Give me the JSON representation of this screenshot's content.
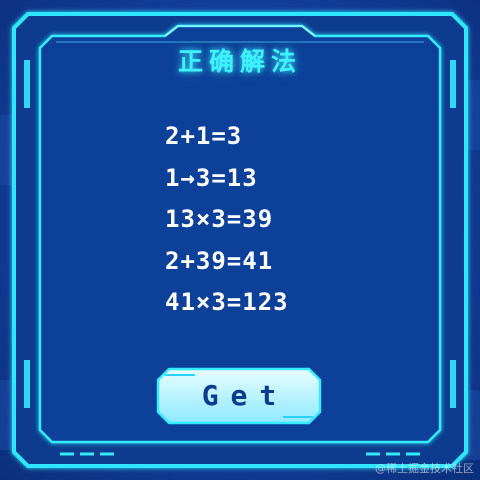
{
  "panel": {
    "title": "正确解法",
    "steps": [
      "2+1=3",
      "1→3=13",
      "13×3=39",
      "2+39=41",
      "41×3=123"
    ]
  },
  "button": {
    "label": "Get"
  },
  "watermark": "@稀土掘金技术社区",
  "colors": {
    "background": "#123f9a",
    "frame_glow": "#3ff2ff",
    "text": "#ffffff",
    "button_fill": "#bff6ff",
    "button_text": "#0c3c8c"
  }
}
